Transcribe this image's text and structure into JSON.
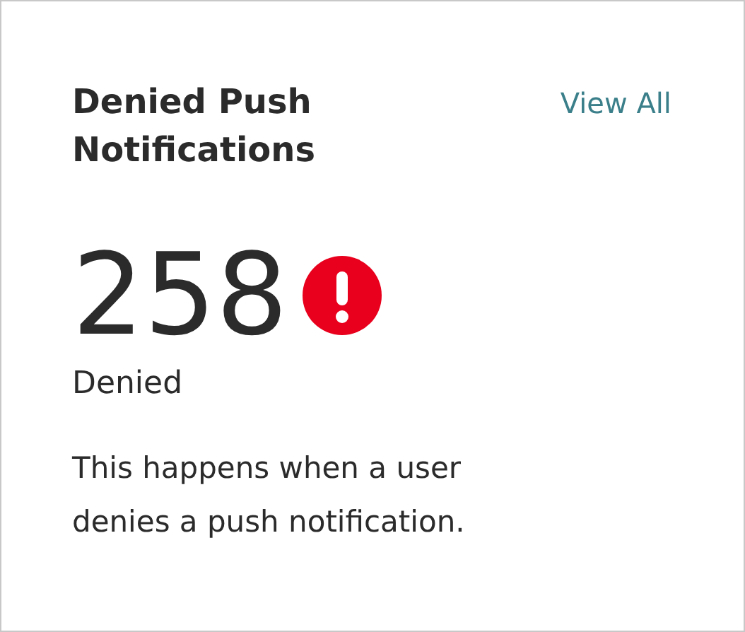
{
  "card": {
    "title": "Denied Push Notifications",
    "link": "View All"
  },
  "metric": {
    "value": "258",
    "label": "Denied",
    "alert": true
  },
  "description": "This happens when a user denies a push notification."
}
